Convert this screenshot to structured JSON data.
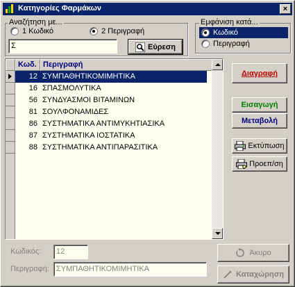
{
  "window": {
    "title": "Κατηγορίες Φαρμάκων",
    "close": "×"
  },
  "search": {
    "group_label": "Αναζήτηση με...",
    "option1": "1  Κωδικό",
    "option2": "2  Περιγραφή",
    "selected": 2,
    "value": "Σ",
    "button": "Εύρεση"
  },
  "display": {
    "group_label": "Εμφάνιση κατά...",
    "options": [
      "Κωδικό",
      "Περιγραφή"
    ],
    "selected": 0
  },
  "grid": {
    "columns": [
      "Κωδ.",
      "Περιγραφή"
    ],
    "rows": [
      {
        "code": "12",
        "desc": "ΣΥΜΠΑΘΗΤΙΚΟΜΙΜΗΤΙΚΑ"
      },
      {
        "code": "16",
        "desc": "ΣΠΑΣΜΟΛΥΤΙΚΑ"
      },
      {
        "code": "56",
        "desc": "ΣΥΝΔΥΑΣΜΟΙ ΒΙΤΑΜΙΝΩΝ"
      },
      {
        "code": "81",
        "desc": "ΣΟΥΛΦΟΝΑΜΙΔΕΣ"
      },
      {
        "code": "86",
        "desc": "ΣΥΣΤΗΜΑΤΙΚΑ ΑΝΤΙΜΥΚΗΤΙΑΣΙΚΑ"
      },
      {
        "code": "87",
        "desc": "ΣΥΣΤΗΜΑΤΙΚΑ ΙΟΣΤΑΤΙΚΑ"
      },
      {
        "code": "88",
        "desc": "ΣΥΣΤΗΜΑΤΙΚΑ ΑΝΤΙΠΑΡΑΣΙΤΙΚΑ"
      }
    ],
    "selected_row": 0
  },
  "actions": {
    "delete": "Διαγραφή",
    "insert": "Εισαγωγή",
    "modify": "Μεταβολή",
    "print": "Εκτύπωση",
    "preview": "Προεπ/ση"
  },
  "detail": {
    "code_label": "Κωδικός:",
    "code_value": "12",
    "desc_label": "Περιγραφή:",
    "desc_value": "ΣΥΜΠΑΘΗΤΙΚΟΜΙΜΗΤΙΚΑ",
    "cancel": "Άκυρο",
    "save": "Καταχώρηση"
  },
  "colors": {
    "title_bar": "#0a246a",
    "delete": "#c00000",
    "insert": "#007f00",
    "modify": "#00007f",
    "field_bg": "#fffff0"
  },
  "icons": [
    "app-icon",
    "search-icon",
    "printer-icon",
    "preview-icon",
    "cancel-icon",
    "save-icon"
  ]
}
